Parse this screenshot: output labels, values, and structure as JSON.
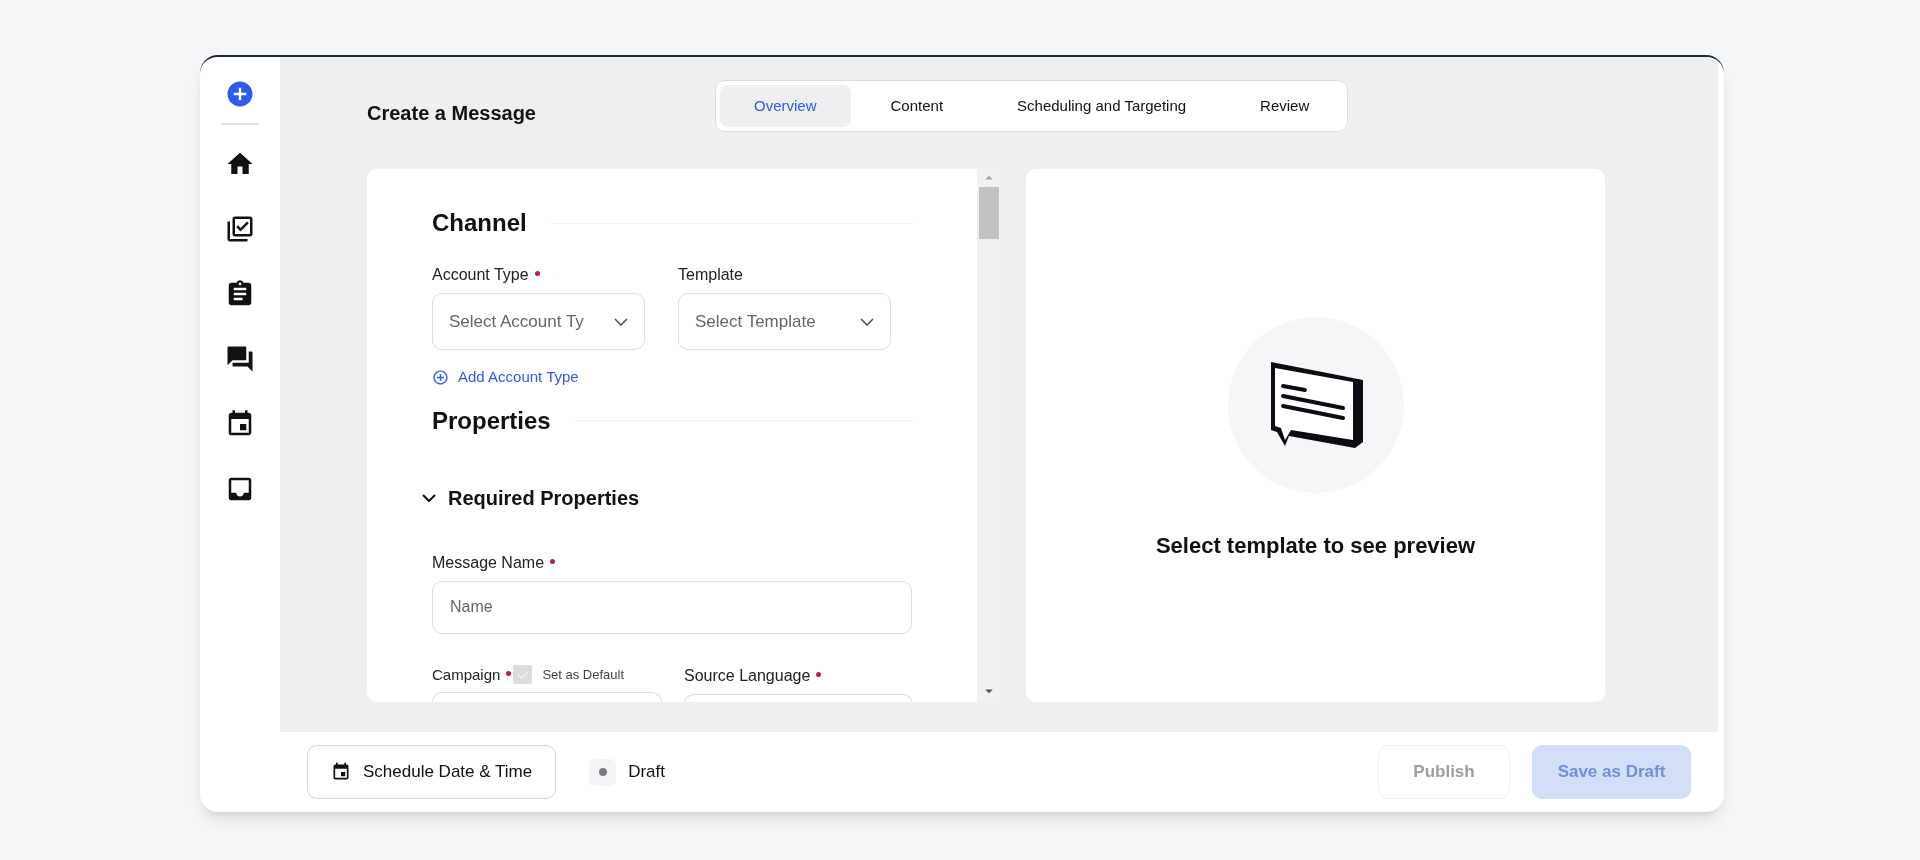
{
  "title": "Create a Message",
  "tabs": [
    {
      "label": "Overview",
      "selected": true
    },
    {
      "label": "Content",
      "selected": false
    },
    {
      "label": "Scheduling and Targeting",
      "selected": false
    },
    {
      "label": "Review",
      "selected": false
    }
  ],
  "channel": {
    "heading": "Channel",
    "fields": [
      {
        "label": "Account Type",
        "required": true,
        "placeholder": "Select Account Ty"
      },
      {
        "label": "Template",
        "required": false,
        "placeholder": "Select Template"
      }
    ],
    "add_link": "Add Account Type"
  },
  "properties": {
    "heading": "Properties",
    "group": {
      "title": "Required Properties",
      "expanded": true
    },
    "message_name": {
      "label": "Message Name",
      "required": true,
      "placeholder": "Name"
    },
    "campaign": {
      "label": "Campaign",
      "required": true,
      "checkbox": {
        "label": "Set as Default",
        "checked": true,
        "disabled": true
      }
    },
    "source_language": {
      "label": "Source Language",
      "required": true
    }
  },
  "preview": {
    "message": "Select template to see preview"
  },
  "footer": {
    "schedule_button": "Schedule Date & Time",
    "status": "Draft",
    "publish": {
      "label": "Publish",
      "disabled": true
    },
    "save": {
      "label": "Save as Draft",
      "disabled": true
    }
  }
}
